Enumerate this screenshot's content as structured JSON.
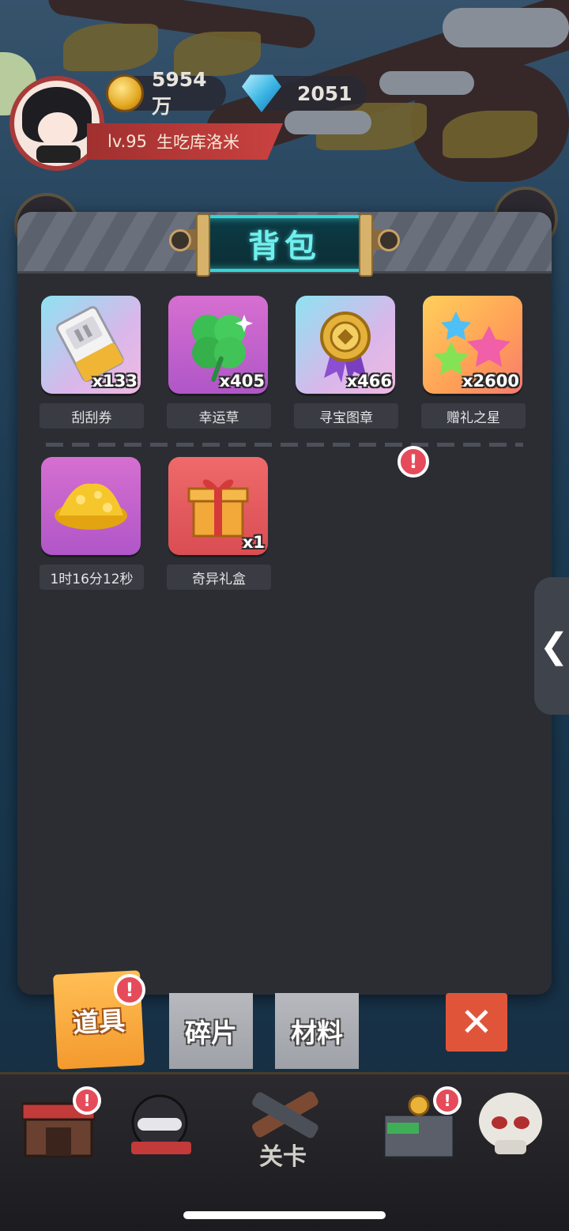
{
  "hud": {
    "coins": "5954万",
    "gems": "2051",
    "level": "lv.95",
    "player_name": "生吃库洛米"
  },
  "panel": {
    "title": "背包"
  },
  "items": [
    {
      "name": "刮刮券",
      "count": "x133",
      "icon": "scratch-ticket-icon"
    },
    {
      "name": "幸运草",
      "count": "x405",
      "icon": "clover-icon"
    },
    {
      "name": "寻宝图章",
      "count": "x466",
      "icon": "medal-icon"
    },
    {
      "name": "赠礼之星",
      "count": "x2600",
      "icon": "stars-icon"
    },
    {
      "name": "1时16分12秒",
      "count": "",
      "icon": "gold-pile-icon"
    },
    {
      "name": "奇异礼盒",
      "count": "x1",
      "icon": "gift-box-icon"
    }
  ],
  "tabs": {
    "items": "道具",
    "fragments": "碎片",
    "materials": "材料"
  },
  "nav": {
    "stage_label": "关卡"
  },
  "alert_mark": "!",
  "close_glyph": "✕",
  "side_glyph": "❮"
}
